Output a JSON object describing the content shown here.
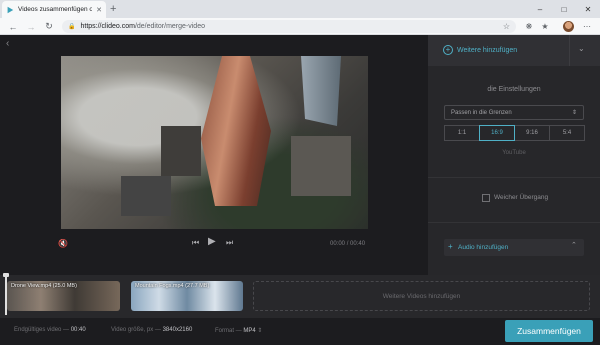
{
  "browser": {
    "tab_title": "Videos zusammenfügen online –",
    "url_base": "https://clideo.com",
    "url_path": "/de/editor/merge-video"
  },
  "editor": {
    "time_current": "00:00",
    "time_separator": "/",
    "time_total": "00:40"
  },
  "panel": {
    "add_more_label": "Weitere hinzufügen",
    "settings_title": "die Einstellungen",
    "fit_mode": "Passen in die Grenzen",
    "ratios": [
      "1:1",
      "16:9",
      "9:16",
      "5:4"
    ],
    "active_ratio": "16:9",
    "platform_label": "YouTube",
    "crossfade_label": "Weicher Übergang",
    "crossfade_checked": false,
    "audio_label": "Audio hinzufügen"
  },
  "timeline": {
    "clips": [
      {
        "label": "Drone View.mp4 (25.0 MB)"
      },
      {
        "label": "Mountain Fogs.mp4 (27.7 MB)"
      }
    ],
    "dropzone_label": "Weitere Videos hinzufügen"
  },
  "footer": {
    "duration_label": "Endgültiges video —",
    "duration_value": "00:40",
    "size_label": "Video größe, px —",
    "size_value": "3840x2160",
    "format_label": "Format —",
    "format_value": "MP4",
    "merge_button": "Zusammenfügen"
  },
  "colors": {
    "accent": "#3aa0b8",
    "background": "#1c1c1f",
    "panel": "#27272a"
  }
}
